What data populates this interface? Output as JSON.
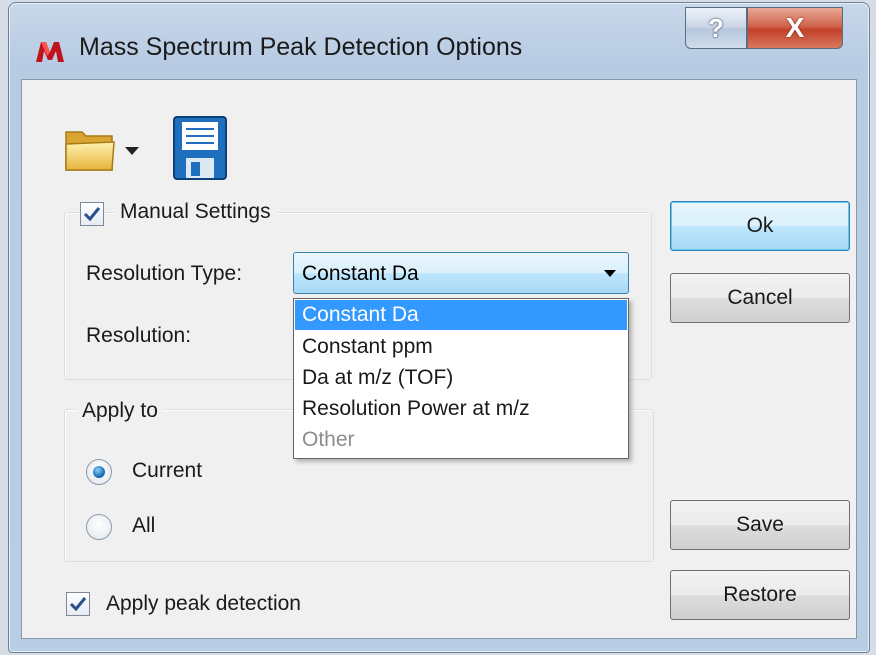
{
  "window": {
    "title": "Mass Spectrum Peak Detection Options",
    "help_glyph": "?",
    "close_glyph": "X"
  },
  "toolbar": {
    "open_icon": "folder-icon",
    "save_icon": "floppy-disk-icon"
  },
  "manual_settings": {
    "label": "Manual Settings",
    "checked": true,
    "resolution_type_label": "Resolution Type:",
    "resolution_type_value": "Constant Da",
    "resolution_label": "Resolution:",
    "options": [
      "Constant Da",
      "Constant ppm",
      "Da at m/z (TOF)",
      "Resolution Power at m/z",
      "Other"
    ],
    "selected_option": "Constant Da",
    "disabled_option": "Other"
  },
  "apply_to": {
    "legend": "Apply to",
    "options": [
      {
        "label": "Current",
        "checked": true
      },
      {
        "label": "All",
        "checked": false
      }
    ]
  },
  "apply_peak_detection": {
    "label": "Apply peak detection",
    "checked": true
  },
  "buttons": {
    "ok": "Ok",
    "cancel": "Cancel",
    "save": "Save",
    "restore": "Restore"
  },
  "colors": {
    "selection": "#3399ff",
    "button_focus_border": "#3c7fb1",
    "close_button": "#c4402a",
    "title_bar": "#b9cde4"
  }
}
